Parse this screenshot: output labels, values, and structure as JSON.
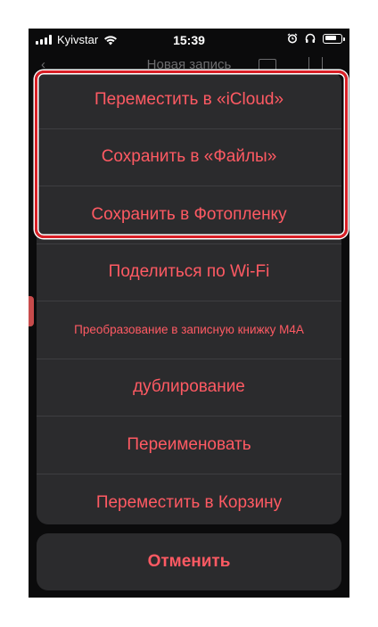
{
  "status_bar": {
    "carrier": "Kyivstar",
    "time": "15:39"
  },
  "background_nav": {
    "title": "Новая запись"
  },
  "action_sheet": {
    "items": [
      {
        "label": "Переместить в «iCloud»"
      },
      {
        "label": "Сохранить в «Файлы»"
      },
      {
        "label": "Сохранить в Фотопленку"
      },
      {
        "label": "Поделиться по Wi-Fi"
      },
      {
        "label": "Преобразование в записную книжку M4A"
      },
      {
        "label": "дублирование"
      },
      {
        "label": "Переименовать"
      },
      {
        "label": "Переместить в Корзину"
      }
    ],
    "cancel_label": "Отменить"
  },
  "colors": {
    "accent_text": "#ff5a63",
    "sheet_bg": "#2b2b2d",
    "highlight_border": "#d91f26"
  }
}
